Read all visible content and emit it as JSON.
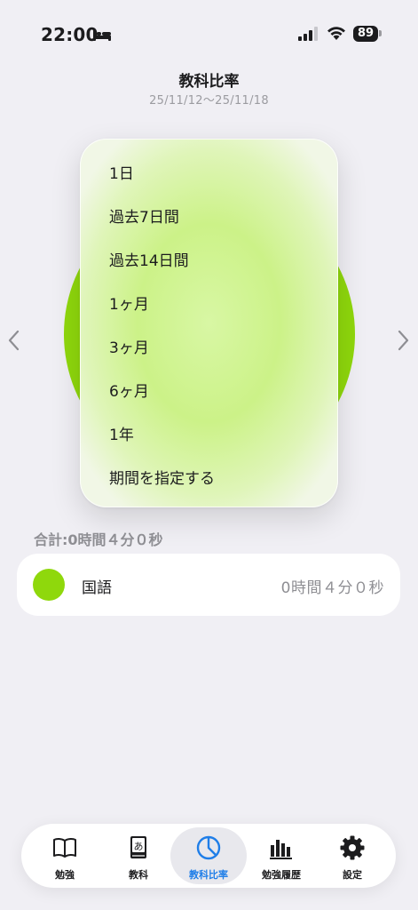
{
  "status_bar": {
    "time": "22:00",
    "battery": "89"
  },
  "header": {
    "title": "教科比率",
    "date_range": "25/11/12～25/11/18"
  },
  "period_menu": {
    "items": [
      "1日",
      "過去7日間",
      "過去14日間",
      "1ヶ月",
      "3ヶ月",
      "6ヶ月",
      "1年",
      "期間を指定する"
    ]
  },
  "summary": {
    "total": "合計:0時間４分０秒"
  },
  "subjects": [
    {
      "name": "国語",
      "time": "0時間４分０秒",
      "color": "#8fd80c"
    }
  ],
  "tabs": [
    {
      "label": "勉強",
      "icon": "book-icon"
    },
    {
      "label": "教科",
      "icon": "kana-book-icon"
    },
    {
      "label": "教科比率",
      "icon": "pie-chart-icon",
      "active": true
    },
    {
      "label": "勉強履歴",
      "icon": "bar-chart-icon"
    },
    {
      "label": "設定",
      "icon": "gear-icon"
    }
  ],
  "colors": {
    "accent": "#1f7ee8",
    "subject_green": "#8fd80c"
  }
}
